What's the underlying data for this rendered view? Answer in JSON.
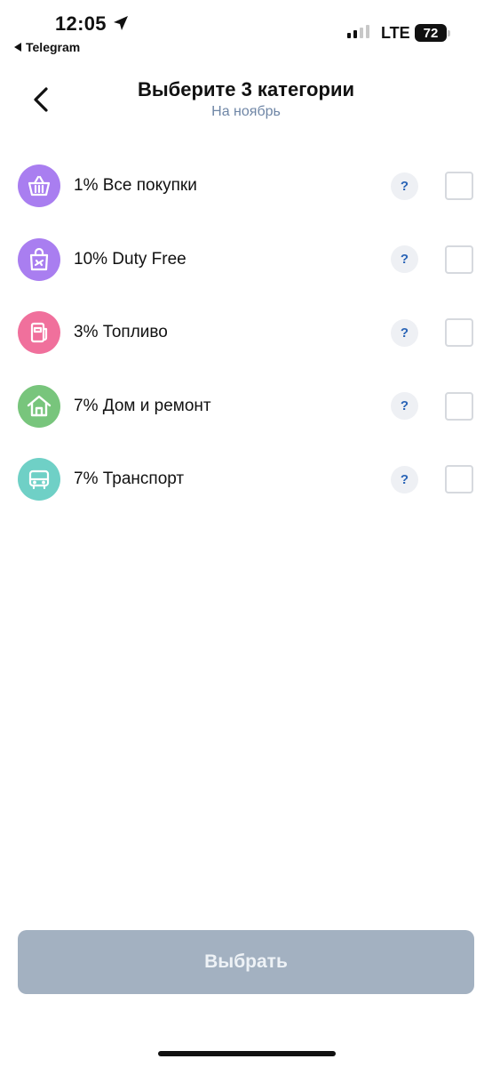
{
  "status_bar": {
    "time": "12:05",
    "back_app": "Telegram",
    "network": "LTE",
    "battery": "72"
  },
  "header": {
    "title": "Выберите 3 категории",
    "subtitle": "На ноябрь"
  },
  "categories": [
    {
      "label": "1% Все покупки",
      "icon": "shopping-basket-icon",
      "color": "#a97ef0"
    },
    {
      "label": "10% Duty Free",
      "icon": "shopping-bag-plane-icon",
      "color": "#a97ef0"
    },
    {
      "label": "3% Топливо",
      "icon": "fuel-pump-icon",
      "color": "#f0709c"
    },
    {
      "label": "7% Дом и ремонт",
      "icon": "house-icon",
      "color": "#78c57c"
    },
    {
      "label": "7% Транспорт",
      "icon": "bus-icon",
      "color": "#6fd0c6"
    }
  ],
  "help_label": "?",
  "button": {
    "label": "Выбрать",
    "color": "#a3b1c1"
  }
}
